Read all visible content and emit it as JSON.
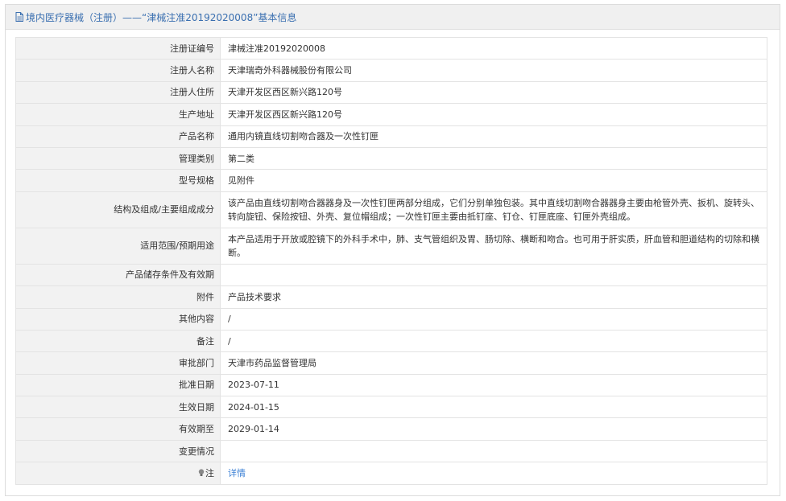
{
  "header": {
    "title": "境内医疗器械（注册）——“津械注准20192020008”基本信息"
  },
  "rows": [
    {
      "label": "注册证编号",
      "value": "津械注准20192020008"
    },
    {
      "label": "注册人名称",
      "value": "天津瑞奇外科器械股份有限公司"
    },
    {
      "label": "注册人住所",
      "value": "天津开发区西区新兴路120号"
    },
    {
      "label": "生产地址",
      "value": "天津开发区西区新兴路120号"
    },
    {
      "label": "产品名称",
      "value": "通用内镜直线切割吻合器及一次性钉匣"
    },
    {
      "label": "管理类别",
      "value": "第二类"
    },
    {
      "label": "型号规格",
      "value": "见附件"
    },
    {
      "label": "结构及组成/主要组成成分",
      "value": "该产品由直线切割吻合器器身及一次性钉匣两部分组成，它们分别单独包装。其中直线切割吻合器器身主要由枪管外壳、扳机、旋转头、转向旋钮、保险按钮、外壳、复位帽组成；一次性钉匣主要由抵钉座、钉仓、钉匣底座、钉匣外壳组成。"
    },
    {
      "label": "适用范围/预期用途",
      "value": "本产品适用于开放或腔镜下的外科手术中，肺、支气管组织及胃、肠切除、横断和吻合。也可用于肝实质，肝血管和胆道结构的切除和横断。"
    },
    {
      "label": "产品储存条件及有效期",
      "value": ""
    },
    {
      "label": "附件",
      "value": "产品技术要求"
    },
    {
      "label": "其他内容",
      "value": "/"
    },
    {
      "label": "备注",
      "value": "/"
    },
    {
      "label": "审批部门",
      "value": "天津市药品监督管理局"
    },
    {
      "label": "批准日期",
      "value": "2023-07-11"
    },
    {
      "label": "生效日期",
      "value": "2024-01-15"
    },
    {
      "label": "有效期至",
      "value": "2029-01-14"
    },
    {
      "label": "变更情况",
      "value": ""
    }
  ],
  "note_row": {
    "label": "注",
    "link_text": "详情",
    "icon": "lightbulb-icon"
  },
  "colors": {
    "header_text": "#3a6fb0",
    "link": "#3a7fd5",
    "label_bg": "#f2f2f2",
    "border": "#e3e3e3"
  }
}
